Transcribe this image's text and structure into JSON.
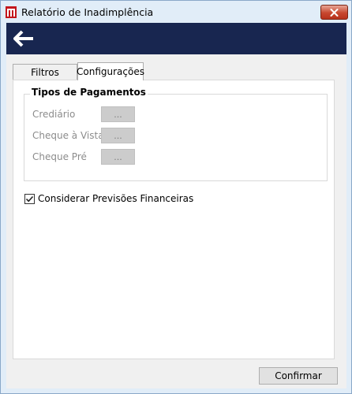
{
  "window": {
    "title": "Relatório de Inadimplência",
    "close_label": "✕"
  },
  "navbar": {
    "back_icon": "arrow-left-icon"
  },
  "tabs": [
    {
      "label": "Filtros",
      "active": false
    },
    {
      "label": "Configurações",
      "active": true
    }
  ],
  "payment_types": {
    "title": "Tipos de Pagamentos",
    "items": [
      {
        "label": "Crediário",
        "button_label": "..."
      },
      {
        "label": "Cheque à Vista",
        "button_label": "..."
      },
      {
        "label": "Cheque Pré",
        "button_label": "..."
      }
    ]
  },
  "options": {
    "forecast_label": "Considerar Previsões Financeiras",
    "forecast_checked": true
  },
  "footer": {
    "confirm_label": "Confirmar"
  },
  "colors": {
    "navbar": "#182650",
    "close_button": "#c7472f",
    "disabled_button": "#cccccc"
  }
}
